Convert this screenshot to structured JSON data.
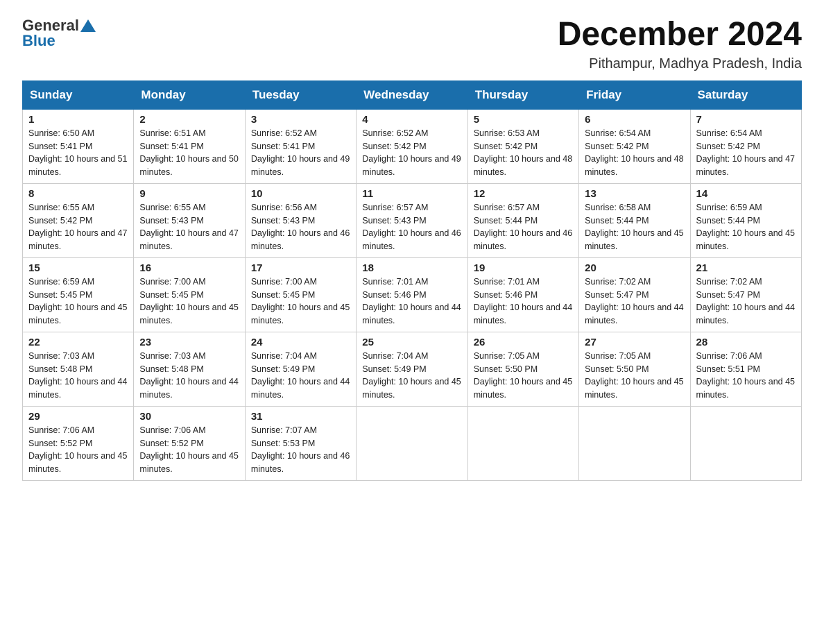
{
  "header": {
    "logo_general": "General",
    "logo_blue": "Blue",
    "month_title": "December 2024",
    "location": "Pithampur, Madhya Pradesh, India"
  },
  "days_of_week": [
    "Sunday",
    "Monday",
    "Tuesday",
    "Wednesday",
    "Thursday",
    "Friday",
    "Saturday"
  ],
  "weeks": [
    [
      {
        "day": "1",
        "sunrise": "6:50 AM",
        "sunset": "5:41 PM",
        "daylight": "10 hours and 51 minutes."
      },
      {
        "day": "2",
        "sunrise": "6:51 AM",
        "sunset": "5:41 PM",
        "daylight": "10 hours and 50 minutes."
      },
      {
        "day": "3",
        "sunrise": "6:52 AM",
        "sunset": "5:41 PM",
        "daylight": "10 hours and 49 minutes."
      },
      {
        "day": "4",
        "sunrise": "6:52 AM",
        "sunset": "5:42 PM",
        "daylight": "10 hours and 49 minutes."
      },
      {
        "day": "5",
        "sunrise": "6:53 AM",
        "sunset": "5:42 PM",
        "daylight": "10 hours and 48 minutes."
      },
      {
        "day": "6",
        "sunrise": "6:54 AM",
        "sunset": "5:42 PM",
        "daylight": "10 hours and 48 minutes."
      },
      {
        "day": "7",
        "sunrise": "6:54 AM",
        "sunset": "5:42 PM",
        "daylight": "10 hours and 47 minutes."
      }
    ],
    [
      {
        "day": "8",
        "sunrise": "6:55 AM",
        "sunset": "5:42 PM",
        "daylight": "10 hours and 47 minutes."
      },
      {
        "day": "9",
        "sunrise": "6:55 AM",
        "sunset": "5:43 PM",
        "daylight": "10 hours and 47 minutes."
      },
      {
        "day": "10",
        "sunrise": "6:56 AM",
        "sunset": "5:43 PM",
        "daylight": "10 hours and 46 minutes."
      },
      {
        "day": "11",
        "sunrise": "6:57 AM",
        "sunset": "5:43 PM",
        "daylight": "10 hours and 46 minutes."
      },
      {
        "day": "12",
        "sunrise": "6:57 AM",
        "sunset": "5:44 PM",
        "daylight": "10 hours and 46 minutes."
      },
      {
        "day": "13",
        "sunrise": "6:58 AM",
        "sunset": "5:44 PM",
        "daylight": "10 hours and 45 minutes."
      },
      {
        "day": "14",
        "sunrise": "6:59 AM",
        "sunset": "5:44 PM",
        "daylight": "10 hours and 45 minutes."
      }
    ],
    [
      {
        "day": "15",
        "sunrise": "6:59 AM",
        "sunset": "5:45 PM",
        "daylight": "10 hours and 45 minutes."
      },
      {
        "day": "16",
        "sunrise": "7:00 AM",
        "sunset": "5:45 PM",
        "daylight": "10 hours and 45 minutes."
      },
      {
        "day": "17",
        "sunrise": "7:00 AM",
        "sunset": "5:45 PM",
        "daylight": "10 hours and 45 minutes."
      },
      {
        "day": "18",
        "sunrise": "7:01 AM",
        "sunset": "5:46 PM",
        "daylight": "10 hours and 44 minutes."
      },
      {
        "day": "19",
        "sunrise": "7:01 AM",
        "sunset": "5:46 PM",
        "daylight": "10 hours and 44 minutes."
      },
      {
        "day": "20",
        "sunrise": "7:02 AM",
        "sunset": "5:47 PM",
        "daylight": "10 hours and 44 minutes."
      },
      {
        "day": "21",
        "sunrise": "7:02 AM",
        "sunset": "5:47 PM",
        "daylight": "10 hours and 44 minutes."
      }
    ],
    [
      {
        "day": "22",
        "sunrise": "7:03 AM",
        "sunset": "5:48 PM",
        "daylight": "10 hours and 44 minutes."
      },
      {
        "day": "23",
        "sunrise": "7:03 AM",
        "sunset": "5:48 PM",
        "daylight": "10 hours and 44 minutes."
      },
      {
        "day": "24",
        "sunrise": "7:04 AM",
        "sunset": "5:49 PM",
        "daylight": "10 hours and 44 minutes."
      },
      {
        "day": "25",
        "sunrise": "7:04 AM",
        "sunset": "5:49 PM",
        "daylight": "10 hours and 45 minutes."
      },
      {
        "day": "26",
        "sunrise": "7:05 AM",
        "sunset": "5:50 PM",
        "daylight": "10 hours and 45 minutes."
      },
      {
        "day": "27",
        "sunrise": "7:05 AM",
        "sunset": "5:50 PM",
        "daylight": "10 hours and 45 minutes."
      },
      {
        "day": "28",
        "sunrise": "7:06 AM",
        "sunset": "5:51 PM",
        "daylight": "10 hours and 45 minutes."
      }
    ],
    [
      {
        "day": "29",
        "sunrise": "7:06 AM",
        "sunset": "5:52 PM",
        "daylight": "10 hours and 45 minutes."
      },
      {
        "day": "30",
        "sunrise": "7:06 AM",
        "sunset": "5:52 PM",
        "daylight": "10 hours and 45 minutes."
      },
      {
        "day": "31",
        "sunrise": "7:07 AM",
        "sunset": "5:53 PM",
        "daylight": "10 hours and 46 minutes."
      },
      null,
      null,
      null,
      null
    ]
  ],
  "labels": {
    "sunrise_prefix": "Sunrise: ",
    "sunset_prefix": "Sunset: ",
    "daylight_prefix": "Daylight: "
  }
}
